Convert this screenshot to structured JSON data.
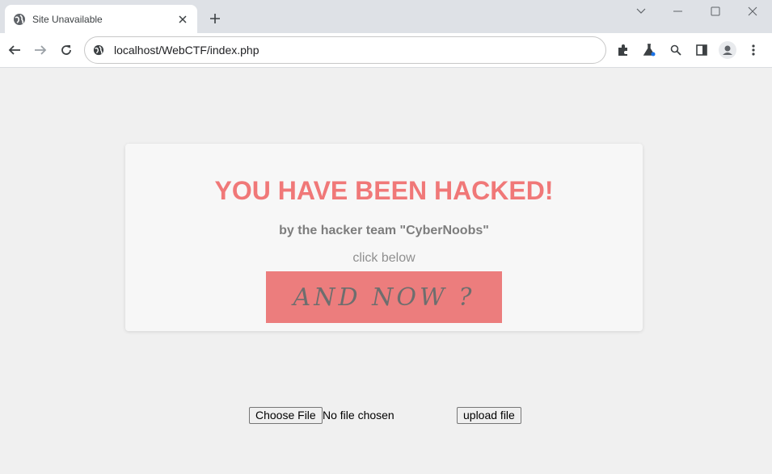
{
  "browser": {
    "tab_title": "Site Unavailable",
    "url": "localhost/WebCTF/index.php"
  },
  "icons": {
    "favicon": "globe-icon",
    "tab_close": "close-icon",
    "new_tab": "plus-icon",
    "back": "arrow-left-icon",
    "forward": "arrow-right-icon",
    "reload": "reload-icon",
    "site_info": "globe-icon",
    "extensions": "puzzle-icon",
    "labs": "flask-icon",
    "search": "search-icon",
    "side_panel": "side-panel-icon",
    "profile": "avatar-icon",
    "menu": "kebab-menu-icon",
    "tab_search": "chevron-down-icon",
    "minimize": "minimize-icon",
    "maximize": "maximize-icon",
    "close_window": "close-icon"
  },
  "page": {
    "headline": "YOU HAVE BEEN HACKED!",
    "byline": "by the hacker team \"CyberNoobs\"",
    "click_text": "click below",
    "cta_label": "AND NOW ?",
    "choose_file_label": "Choose File",
    "file_status": "No file chosen",
    "upload_label": "upload file"
  },
  "colors": {
    "headline": "#f07878",
    "cta_background": "#ec7d7d",
    "page_background": "#f0f0f0",
    "card_background": "#f7f7f7"
  }
}
